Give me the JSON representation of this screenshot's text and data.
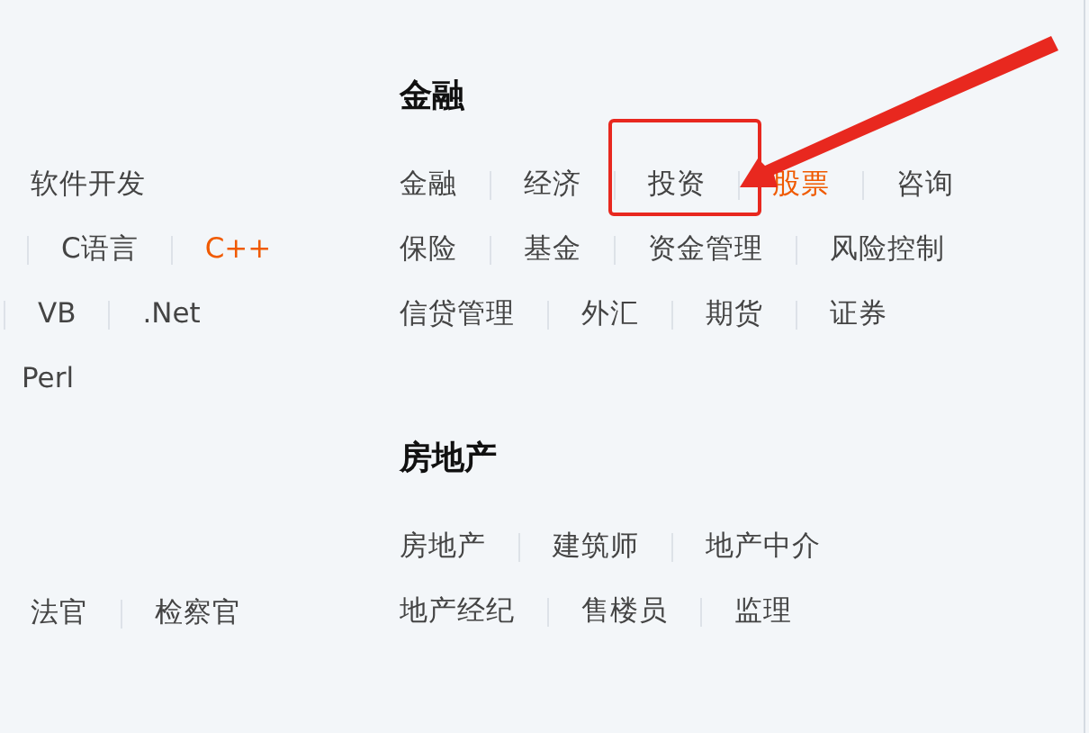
{
  "left_column": {
    "rows": [
      {
        "leading_divider": false,
        "items": [
          {
            "label": "软件开发",
            "hot": false
          }
        ]
      },
      {
        "leading_divider": true,
        "items": [
          {
            "label": "C语言",
            "hot": false
          },
          {
            "label": "C++",
            "hot": true
          }
        ]
      },
      {
        "leading_divider": true,
        "items": [
          {
            "label": "VB",
            "hot": false
          },
          {
            "label": ".Net",
            "hot": false
          }
        ]
      },
      {
        "leading_divider": false,
        "items": [
          {
            "label": "Perl",
            "hot": false
          }
        ]
      }
    ],
    "lower_rows": [
      {
        "leading_divider": false,
        "items": [
          {
            "label": "法官",
            "hot": false
          },
          {
            "label": "检察官",
            "hot": false
          }
        ]
      }
    ]
  },
  "sections": [
    {
      "title": "金融",
      "rows": [
        [
          {
            "label": "金融",
            "hot": false,
            "highlighted": false
          },
          {
            "label": "经济",
            "hot": false,
            "highlighted": false
          },
          {
            "label": "投资",
            "hot": false,
            "highlighted": true
          },
          {
            "label": "股票",
            "hot": true,
            "highlighted": false
          },
          {
            "label": "咨询",
            "hot": false,
            "highlighted": false
          }
        ],
        [
          {
            "label": "保险",
            "hot": false,
            "highlighted": false
          },
          {
            "label": "基金",
            "hot": false,
            "highlighted": false
          },
          {
            "label": "资金管理",
            "hot": false,
            "highlighted": false
          },
          {
            "label": "风险控制",
            "hot": false,
            "highlighted": false
          }
        ],
        [
          {
            "label": "信贷管理",
            "hot": false,
            "highlighted": false
          },
          {
            "label": "外汇",
            "hot": false,
            "highlighted": false
          },
          {
            "label": "期货",
            "hot": false,
            "highlighted": false
          },
          {
            "label": "证券",
            "hot": false,
            "highlighted": false
          }
        ]
      ]
    },
    {
      "title": "房地产",
      "rows": [
        [
          {
            "label": "房地产",
            "hot": false,
            "highlighted": false
          },
          {
            "label": "建筑师",
            "hot": false,
            "highlighted": false
          },
          {
            "label": "地产中介",
            "hot": false,
            "highlighted": false
          }
        ],
        [
          {
            "label": "地产经纪",
            "hot": false,
            "highlighted": false
          },
          {
            "label": "售楼员",
            "hot": false,
            "highlighted": false
          },
          {
            "label": "监理",
            "hot": false,
            "highlighted": false
          }
        ]
      ]
    }
  ]
}
